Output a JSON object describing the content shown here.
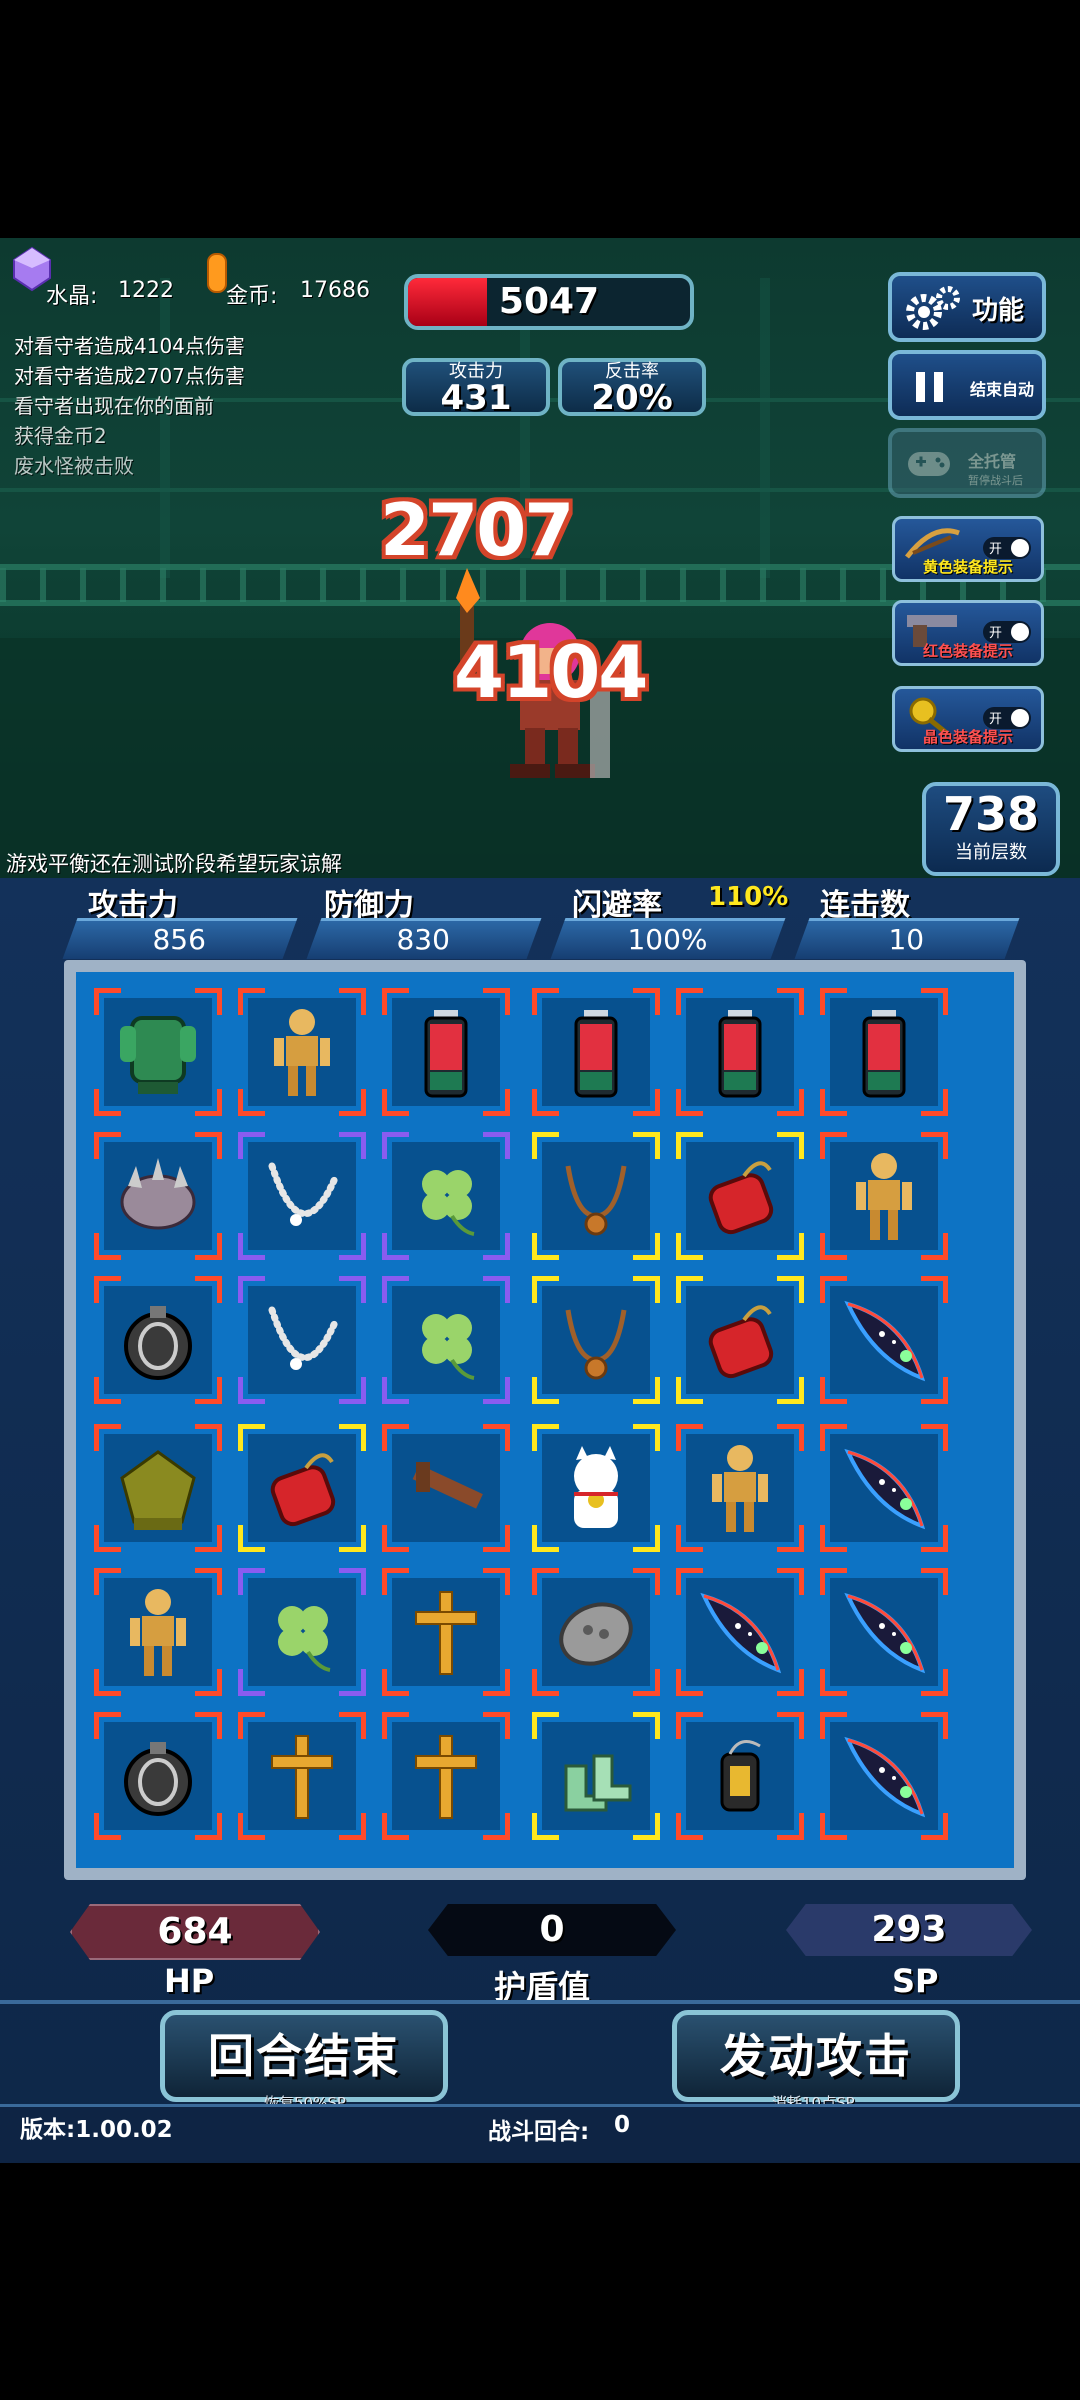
{
  "resources": {
    "crystal_label": "水晶:",
    "crystal_value": "1222",
    "gold_label": "金币:",
    "gold_value": "17686"
  },
  "enemy": {
    "hp": "5047",
    "hp_fraction": 0.28
  },
  "enemy_stats": {
    "attack_label": "攻击力",
    "attack_value": "431",
    "counter_label": "反击率",
    "counter_value": "20%"
  },
  "battle_log": [
    "对看守者造成4104点伤害",
    "对看守者造成2707点伤害",
    "看守者出现在你的面前",
    "获得金币2",
    "废水怪被击败"
  ],
  "damage_numbers": [
    "2707",
    "4104"
  ],
  "side_buttons": {
    "function_label": "功能",
    "auto_label": "结束自动",
    "manager_label": "全托管",
    "manager_sub": "暂停战斗后",
    "toggles": [
      {
        "label": "黄色装备提示",
        "state": "开"
      },
      {
        "label": "红色装备提示",
        "state": "开"
      },
      {
        "label": "晶色装备提示",
        "state": "开"
      }
    ]
  },
  "floor": {
    "value": "738",
    "label": "当前层数"
  },
  "notice": "游戏平衡还在测试阶段希望玩家谅解",
  "player_stats": {
    "attack_label": "攻击力",
    "attack_value": "856",
    "defense_label": "防御力",
    "defense_value": "830",
    "dodge_label": "闪避率",
    "dodge_bonus": "110%",
    "dodge_value": "100%",
    "combo_label": "连击数",
    "combo_value": "10"
  },
  "board": [
    [
      {
        "item": "green-armor-icon",
        "rarity": "red"
      },
      {
        "item": "golden-skeleton-icon",
        "rarity": "red"
      },
      {
        "item": "battery-icon",
        "rarity": "red"
      },
      {
        "item": "battery-icon",
        "rarity": "red"
      },
      {
        "item": "battery-icon",
        "rarity": "red"
      },
      {
        "item": "battery-icon",
        "rarity": "red"
      }
    ],
    [
      {
        "item": "spiked-helmet-icon",
        "rarity": "red"
      },
      {
        "item": "pearl-necklace-icon",
        "rarity": "purple"
      },
      {
        "item": "clover-icon",
        "rarity": "purple"
      },
      {
        "item": "amulet-icon",
        "rarity": "yellow"
      },
      {
        "item": "red-pouch-icon",
        "rarity": "yellow"
      },
      {
        "item": "golden-skeleton-icon",
        "rarity": "red"
      }
    ],
    [
      {
        "item": "grenade-icon",
        "rarity": "red"
      },
      {
        "item": "pearl-necklace-icon",
        "rarity": "purple"
      },
      {
        "item": "clover-icon",
        "rarity": "purple"
      },
      {
        "item": "amulet-icon",
        "rarity": "yellow"
      },
      {
        "item": "red-pouch-icon",
        "rarity": "yellow"
      },
      {
        "item": "star-feather-icon",
        "rarity": "red"
      }
    ],
    [
      {
        "item": "gargoyle-statue-icon",
        "rarity": "red"
      },
      {
        "item": "red-pouch-icon",
        "rarity": "yellow"
      },
      {
        "item": "wooden-crossbow-icon",
        "rarity": "red"
      },
      {
        "item": "lucky-cat-icon",
        "rarity": "yellow"
      },
      {
        "item": "golden-skeleton-icon",
        "rarity": "red"
      },
      {
        "item": "star-feather-icon",
        "rarity": "red"
      }
    ],
    [
      {
        "item": "golden-skeleton-icon",
        "rarity": "red"
      },
      {
        "item": "clover-icon",
        "rarity": "purple"
      },
      {
        "item": "golden-cross-icon",
        "rarity": "red"
      },
      {
        "item": "stone-tablet-icon",
        "rarity": "red"
      },
      {
        "item": "star-feather-icon",
        "rarity": "red"
      },
      {
        "item": "star-feather-icon",
        "rarity": "red"
      }
    ],
    [
      {
        "item": "grenade-icon",
        "rarity": "red"
      },
      {
        "item": "golden-cross-icon",
        "rarity": "red"
      },
      {
        "item": "golden-cross-icon",
        "rarity": "red"
      },
      {
        "item": "green-boots-icon",
        "rarity": "yellow"
      },
      {
        "item": "lantern-icon",
        "rarity": "red"
      },
      {
        "item": "star-feather-icon",
        "rarity": "red"
      }
    ]
  ],
  "player_bars": {
    "hp_value": "684",
    "hp_label": "HP",
    "shield_value": "0",
    "shield_label": "护盾值",
    "sp_value": "293",
    "sp_label": "SP"
  },
  "actions": {
    "end_turn_label": "回合结束",
    "end_turn_sub": "恢复50%SP",
    "attack_label": "发动攻击",
    "attack_sub": "消耗10点SP"
  },
  "footer": {
    "version": "版本:1.00.02",
    "round_label": "战斗回合:",
    "round_value": "0"
  },
  "colors": {
    "red_rarity": "#ff4a2a",
    "purple_rarity": "#8a5cf0",
    "yellow_rarity": "#ffe81e",
    "board_blue": "#0d73c4",
    "hp_red": "#ff2a3a"
  }
}
